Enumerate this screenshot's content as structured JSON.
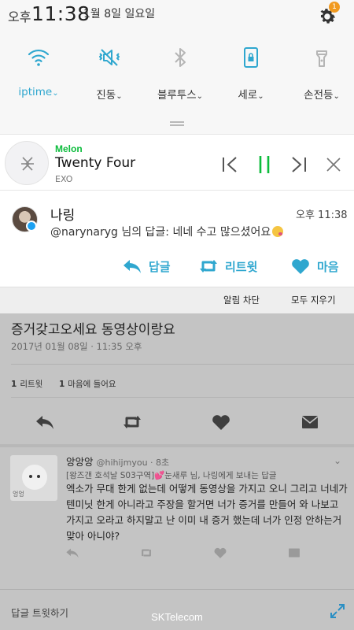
{
  "status": {
    "ampm": "오후",
    "time": "11:38",
    "date": "1월 8일 일요일",
    "settings_badge": "1"
  },
  "quick_tiles": [
    {
      "label": "iptime",
      "icon": "wifi-icon",
      "active": true
    },
    {
      "label": "진동",
      "icon": "vibrate-icon",
      "active": false
    },
    {
      "label": "블루투스",
      "icon": "bluetooth-icon",
      "active": false
    },
    {
      "label": "세로",
      "icon": "rotation-lock-icon",
      "active": false
    },
    {
      "label": "손전등",
      "icon": "flashlight-icon",
      "active": false
    }
  ],
  "melon": {
    "app": "Melon",
    "song": "Twenty Four",
    "artist": "EXO"
  },
  "twitter_notification": {
    "name": "나링",
    "time": "오후 11:38",
    "message": "@narynaryg 님의 답글: 네네 수고 많으셨어요",
    "actions": {
      "reply": "답글",
      "retweet": "리트윗",
      "like": "마음"
    }
  },
  "notification_bar": {
    "block": "알림 차단",
    "clear_all": "모두 지우기"
  },
  "background_tweet": {
    "headline": "증거갖고오세요 동영상이랑요",
    "timestamp": "2017년 01월 08일 · 11:35 오후",
    "retweet_count": "1",
    "retweet_label": "리트윗",
    "like_count": "1",
    "like_label": "마음에 들어요"
  },
  "reply": {
    "avatar_tag": "엉엉",
    "name": "앙앙앙",
    "handle": "@hihijmyou · 8초",
    "context": "[왕즈갠 호석날 S03구역]",
    "context_rest": "눈새루 님, 나링에게 보내는 답글",
    "text": "엑소가 무대 한게 없는데 어떻게 동영상을 가지고 오니 그리고 너네가 텐미닛 한게 아니라고 주장을 할거면 너가 증거를 만들어 와 나보고 가지고 오라고 하지말고 난 이미 내 증거 했는데 너가 인정 안하는거 맞아 아니야?",
    "caret": "⌄"
  },
  "reply_bar": {
    "placeholder": "답글 트윗하기"
  },
  "carrier": "SKTelecom",
  "colors": {
    "accent": "#2fa7cf",
    "melon_green": "#0cbc3c",
    "badge": "#f19a20"
  }
}
